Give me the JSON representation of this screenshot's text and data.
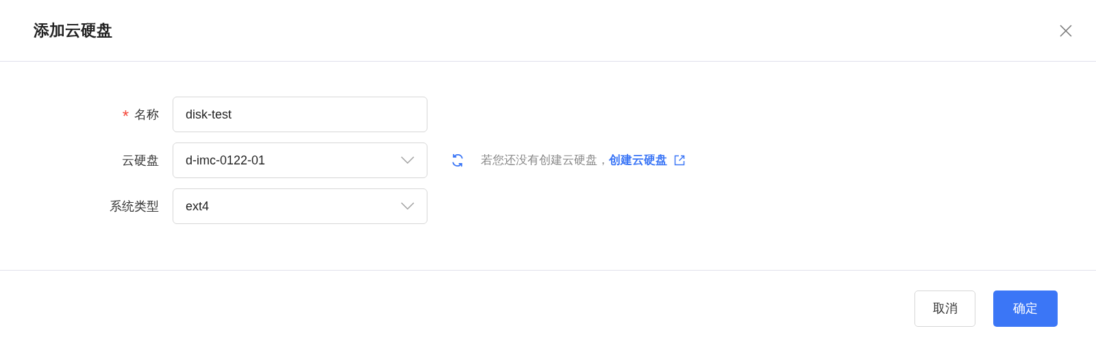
{
  "dialog": {
    "title": "添加云硬盘"
  },
  "fields": [
    {
      "label": "名称",
      "required_mark": "*",
      "kind": "input",
      "value": "disk-test"
    },
    {
      "label": "云硬盘",
      "kind": "select",
      "value": "d-imc-0122-01",
      "hint": {
        "text": "若您还没有创建云硬盘，",
        "link": "创建云硬盘"
      }
    },
    {
      "label": "系统类型",
      "kind": "select",
      "value": "ext4"
    }
  ],
  "buttons": [
    {
      "label": "取消",
      "kind": "secondary"
    },
    {
      "label": "确定",
      "kind": "primary"
    }
  ]
}
